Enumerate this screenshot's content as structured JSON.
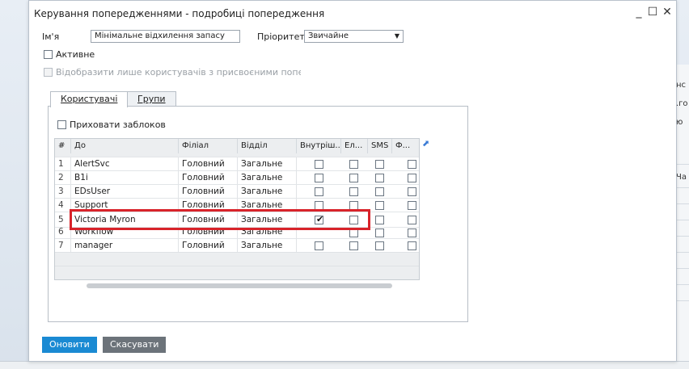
{
  "window": {
    "title": "Керування попередженнями - подробиці попередження",
    "minimize_icon": "minimize-icon",
    "maximize_icon": "maximize-icon",
    "close_icon": "close-icon"
  },
  "form": {
    "name_label": "Ім'я",
    "name_value": "Мінімальне відхилення запасу",
    "priority_label": "Пріоритет",
    "priority_value": "Звичайне",
    "active_label": "Активне",
    "show_only_label": "Відобразити лише користувачів з присвоєними попередженнями"
  },
  "tabs": [
    {
      "label": "Користувачі",
      "active": true
    },
    {
      "label": "Групи",
      "active": false
    }
  ],
  "users_tab": {
    "hide_locked_label": "Приховати заблоков"
  },
  "grid": {
    "headers": [
      "#",
      "До",
      "Філіал",
      "Відділ",
      "Внутріш...",
      "Ел...",
      "SMS",
      "Ф..."
    ],
    "rows": [
      {
        "num": "1",
        "to": "AlertSvc",
        "branch": "Головний",
        "dept": "Загальне",
        "internal": false
      },
      {
        "num": "2",
        "to": "B1i",
        "branch": "Головний",
        "dept": "Загальне",
        "internal": false
      },
      {
        "num": "3",
        "to": "EDsUser",
        "branch": "Головний",
        "dept": "Загальне",
        "internal": false
      },
      {
        "num": "4",
        "to": "Support",
        "branch": "Головний",
        "dept": "Загальне",
        "internal": false
      },
      {
        "num": "5",
        "to": "Victoria Myron",
        "branch": "Головний",
        "dept": "Загальне",
        "internal": true
      },
      {
        "num": "6",
        "to": "Workflow",
        "branch": "Головний",
        "dept": "Загальне",
        "internal": false
      },
      {
        "num": "7",
        "to": "manager",
        "branch": "Головний",
        "dept": "Загальне",
        "internal": false
      }
    ],
    "expand_icon": "expand-arrow-icon"
  },
  "buttons": {
    "update": "Оновити",
    "cancel": "Скасувати"
  },
  "background": {
    "cut_texts": [
      "нс",
      ".го",
      "ю",
      "Ча"
    ]
  },
  "colors": {
    "primary_button": "#1a8ad3",
    "secondary_button": "#6c737a",
    "highlight": "#d8232a"
  }
}
